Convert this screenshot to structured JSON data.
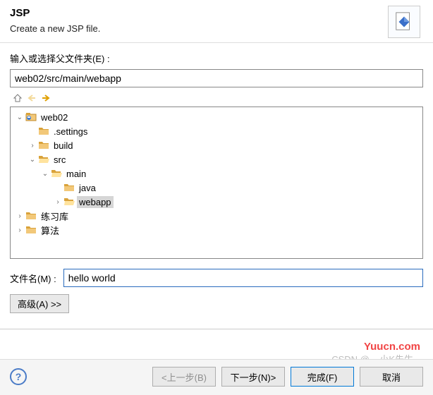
{
  "header": {
    "title": "JSP",
    "subtitle": "Create a new JSP file."
  },
  "labels": {
    "parent_folder": "输入或选择父文件夹(E) :",
    "filename": "文件名(M) :"
  },
  "path_input": {
    "value": "web02/src/main/webapp"
  },
  "tree": {
    "items": [
      {
        "label": "web02",
        "indent": 1,
        "expander": "v",
        "icon": "project",
        "selected": false
      },
      {
        "label": ".settings",
        "indent": 2,
        "expander": "",
        "icon": "folder",
        "selected": false
      },
      {
        "label": "build",
        "indent": 2,
        "expander": ">",
        "icon": "folder",
        "selected": false
      },
      {
        "label": "src",
        "indent": 2,
        "expander": "v",
        "icon": "folder-open",
        "selected": false
      },
      {
        "label": "main",
        "indent": 3,
        "expander": "v",
        "icon": "folder-open",
        "selected": false
      },
      {
        "label": "java",
        "indent": 4,
        "expander": "",
        "icon": "folder",
        "selected": false
      },
      {
        "label": "webapp",
        "indent": 4,
        "expander": ">",
        "icon": "folder-open",
        "selected": true
      },
      {
        "label": "练习库",
        "indent": 1,
        "expander": ">",
        "icon": "folder",
        "selected": false
      },
      {
        "label": "算法",
        "indent": 1,
        "expander": ">",
        "icon": "folder",
        "selected": false
      }
    ]
  },
  "filename_input": {
    "value": "hello world"
  },
  "buttons": {
    "advanced": "高级(A) >>",
    "back": "<上一步(B)",
    "next": "下一步(N)>",
    "finish": "完成(F)",
    "cancel": "取消"
  },
  "watermark": {
    "line1": "Yuucn.com",
    "line2": "CSDN @__小K先生"
  }
}
